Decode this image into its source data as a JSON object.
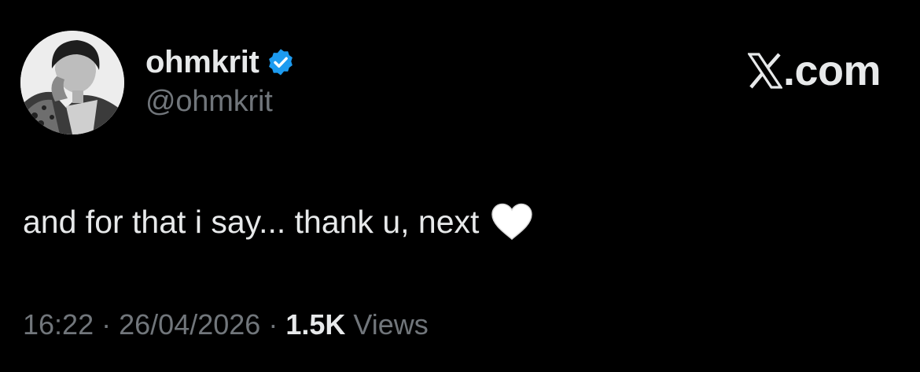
{
  "author": {
    "display_name": "ohmkrit",
    "handle": "@ohmkrit",
    "verified_icon": "verified-badge-icon",
    "verified_color": "#1d9bf0"
  },
  "brand": {
    "logo_icon": "x-logo-icon",
    "label": ".com"
  },
  "tweet": {
    "text": "and for that i say... thank u, next",
    "emoji_icon": "white-heart-icon"
  },
  "meta": {
    "time": "16:22",
    "separator": "·",
    "date": "26/04/2026",
    "views_count": "1.5K",
    "views_label": "Views"
  },
  "colors": {
    "background": "#000000",
    "primary_text": "#e7e9ea",
    "secondary_text": "#71767b"
  }
}
